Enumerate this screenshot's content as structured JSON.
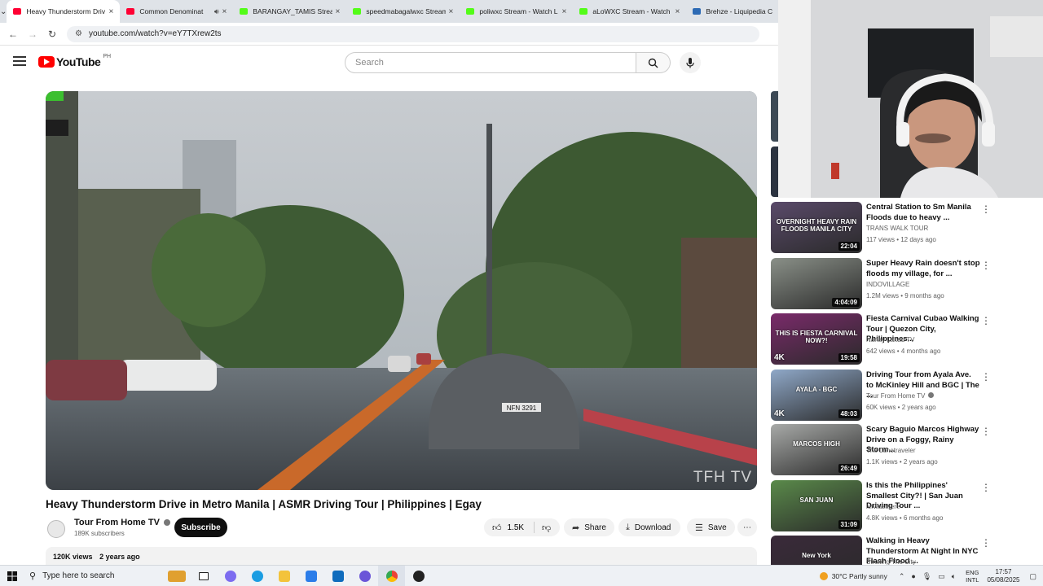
{
  "browser": {
    "tabs": [
      {
        "title": "Heavy Thunderstorm Driv",
        "favicon_color": "#ff0033",
        "active": true
      },
      {
        "title": "Common Denominat",
        "favicon_color": "#ff0033",
        "active": false,
        "audio": true
      },
      {
        "title": "BARANGAY_TAMIS Stream",
        "favicon_color": "#53fc18",
        "active": false
      },
      {
        "title": "speedmabagalwxc Stream",
        "favicon_color": "#53fc18",
        "active": false
      },
      {
        "title": "poliwxc Stream - Watch L",
        "favicon_color": "#53fc18",
        "active": false
      },
      {
        "title": "aLoWXC Stream - Watch",
        "favicon_color": "#53fc18",
        "active": false
      },
      {
        "title": "Brehze - Liquipedia C",
        "favicon_color": "#2d6ab4",
        "active": false
      }
    ],
    "url": "youtube.com/watch?v=eY7TXrew2ts"
  },
  "youtube": {
    "logo_text": "YouTube",
    "country_code": "PH",
    "search_placeholder": "Search"
  },
  "video": {
    "title": "Heavy Thunderstorm Drive in Metro Manila | ASMR Driving Tour | Philippines | Egay",
    "watermark": "TFH TV",
    "channel": "Tour From Home TV",
    "subscribers": "189K subscribers",
    "subscribe_label": "Subscribe",
    "likes": "1.5K",
    "share_label": "Share",
    "download_label": "Download",
    "save_label": "Save",
    "views": "120K views",
    "age": "2 years ago",
    "plate": "NFN 3291"
  },
  "recommendations": [
    {
      "title": "Central Station to Sm Manila Floods due to heavy ...",
      "channel": "TRANS WALK TOUR",
      "meta": "117 views • 12 days ago",
      "duration": "22:04",
      "thumb_color": "#5a4a6a",
      "thumb_text": "OVERNIGHT HEAVY RAIN FLOODS MANILA CITY"
    },
    {
      "title": "Super Heavy Rain doesn't stop floods my village, for ...",
      "channel": "INDOVILLAGE",
      "meta": "1.2M views • 9 months ago",
      "duration": "4:04:09",
      "thumb_color": "#8a9088",
      "thumb_text": ""
    },
    {
      "title": "Fiesta Carnival Cubao Walking Tour | Quezon City, Philippines...",
      "channel": "Nanay Lakad TV",
      "meta": "642 views • 4 months ago",
      "duration": "19:58",
      "thumb_color": "#7a2a6a",
      "thumb_text": "THIS IS FIESTA CARNIVAL NOW?!",
      "badge": "4K"
    },
    {
      "title": "Driving Tour from Ayala Ave. to McKinley Hill and BGC | The ...",
      "channel": "Tour From Home TV",
      "meta": "60K views • 2 years ago",
      "duration": "48:03",
      "thumb_color": "#8fa8c8",
      "thumb_text": "AYALA - BGC",
      "badge": "4K",
      "verified": true
    },
    {
      "title": "Scary Baguio Marcos Highway Drive on a Foggy, Rainy Storm...",
      "channel": "The Lonetraveler",
      "meta": "1.1K views • 2 years ago",
      "duration": "26:49",
      "thumb_color": "#a8aaa8",
      "thumb_text": "MARCOS HIGH"
    },
    {
      "title": "Is this the Philippines' Smallest City?! | San Juan Driving Tour ...",
      "channel": "lerwasthere",
      "meta": "4.8K views • 6 months ago",
      "duration": "31:09",
      "thumb_color": "#5a8a4a",
      "thumb_text": "SAN JUAN"
    },
    {
      "title": "Walking in Heavy Thunderstorm At Night In NYC Flash Flood ...",
      "channel": "Strolling The City",
      "meta": "",
      "duration": "",
      "thumb_color": "#3a2a3a",
      "thumb_text": "New York"
    }
  ],
  "taskbar": {
    "search_placeholder": "Type here to search",
    "weather": "30°C  Partly sunny",
    "lang_top": "ENG",
    "lang_bottom": "INTL",
    "time": "17:57",
    "date": "05/08/2025"
  }
}
